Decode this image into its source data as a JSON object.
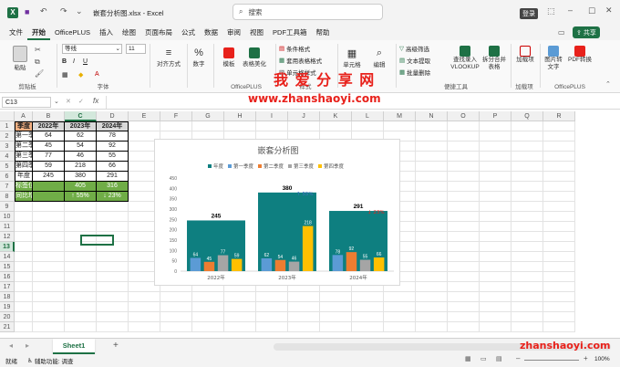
{
  "window": {
    "file_title": "嵌套分析图.xlsx  -  Excel",
    "search_placeholder": "搜索",
    "login_label": "登录",
    "share_label": "共享"
  },
  "menu": [
    "文件",
    "开始",
    "OfficePLUS",
    "插入",
    "绘图",
    "页面布局",
    "公式",
    "数据",
    "审阅",
    "视图",
    "PDF工具箱",
    "帮助"
  ],
  "ribbon": {
    "paste": "粘贴",
    "clipboard": "剪贴板",
    "font_name": "等线",
    "font_size": "11",
    "font_group": "字体",
    "align": "对齐方式",
    "number": "数字",
    "template": "模板",
    "table_beautify": "表格美化",
    "officeplus": "OfficePLUS",
    "cond_format": "条件格式",
    "table_format": "套用表格格式",
    "cell_style": "单元格样式",
    "style_group": "样式",
    "cells": "单元格",
    "edit": "编辑",
    "adv_filter": "高级筛选",
    "text_extract": "文本提取",
    "batch_delete": "批量删除",
    "vlookup": "查找录入VLOOKUP",
    "split_merge": "拆分合并表格",
    "quick_tools": "便捷工具",
    "addins": "加载项",
    "addin_group": "加载项",
    "img_to_text": "图片转文字",
    "pdf_convert": "PDF转换",
    "officeplus2": "OfficePLUS"
  },
  "formula": {
    "name_box": "C13",
    "fx": "fx",
    "content": ""
  },
  "grid": {
    "columns": [
      "A",
      "B",
      "C",
      "D",
      "E",
      "F",
      "G",
      "H",
      "I",
      "J",
      "K",
      "L",
      "M",
      "N",
      "O",
      "P",
      "Q",
      "R"
    ],
    "selected_col": "C",
    "selected_row": "13",
    "rows": [
      "1",
      "2",
      "3",
      "4",
      "5",
      "6",
      "7",
      "8",
      "9",
      "10",
      "11",
      "12",
      "13",
      "14",
      "15",
      "16",
      "17",
      "18",
      "19",
      "20",
      "21"
    ],
    "table": {
      "header": [
        "季度",
        "2022年",
        "2023年",
        "2024年"
      ],
      "body": [
        [
          "第一季度",
          "64",
          "62",
          "78"
        ],
        [
          "第二季度",
          "45",
          "54",
          "92"
        ],
        [
          "第三季度",
          "77",
          "46",
          "55"
        ],
        [
          "第四季度",
          "59",
          "218",
          "66"
        ],
        [
          "年度",
          "245",
          "380",
          "291"
        ]
      ],
      "label_row": [
        "标签位置",
        "",
        "405",
        "316"
      ],
      "growth_row": [
        "同比增长",
        "",
        "↑ 55%",
        "↓ 23%"
      ]
    }
  },
  "watermark": {
    "title": "我 爱 分 享 网",
    "url": "www.zhanshaoyi.com",
    "url2": "zhanshaoyi.com"
  },
  "chart_data": {
    "type": "bar",
    "title": "嵌套分析图",
    "legend": [
      "年度",
      "第一季度",
      "第二季度",
      "第三季度",
      "第四季度"
    ],
    "legend_position": "top",
    "colors": [
      "#0e7f80",
      "#5b9bd5",
      "#ed7d31",
      "#a5a5a5",
      "#ffc000"
    ],
    "categories": [
      "2022年",
      "2023年",
      "2024年"
    ],
    "annual": [
      245,
      380,
      291
    ],
    "series": [
      {
        "name": "第一季度",
        "values": [
          64,
          62,
          78
        ]
      },
      {
        "name": "第二季度",
        "values": [
          45,
          54,
          92
        ]
      },
      {
        "name": "第三季度",
        "values": [
          77,
          46,
          55
        ]
      },
      {
        "name": "第四季度",
        "values": [
          59,
          218,
          66
        ]
      }
    ],
    "growth_labels": [
      "",
      "↑ 55%",
      "↓ 23%"
    ],
    "growth_colors": [
      "#000000",
      "#4472c4",
      "#e8211b"
    ],
    "ylim": [
      0,
      450
    ],
    "yticks": [
      "0",
      "50",
      "100",
      "150",
      "200",
      "250",
      "300",
      "350",
      "400",
      "450"
    ]
  },
  "sheet": {
    "tab": "Sheet1",
    "add": "+",
    "status_ready": "就绪",
    "status_access": "辅助功能: 调查",
    "zoom": "100%"
  }
}
